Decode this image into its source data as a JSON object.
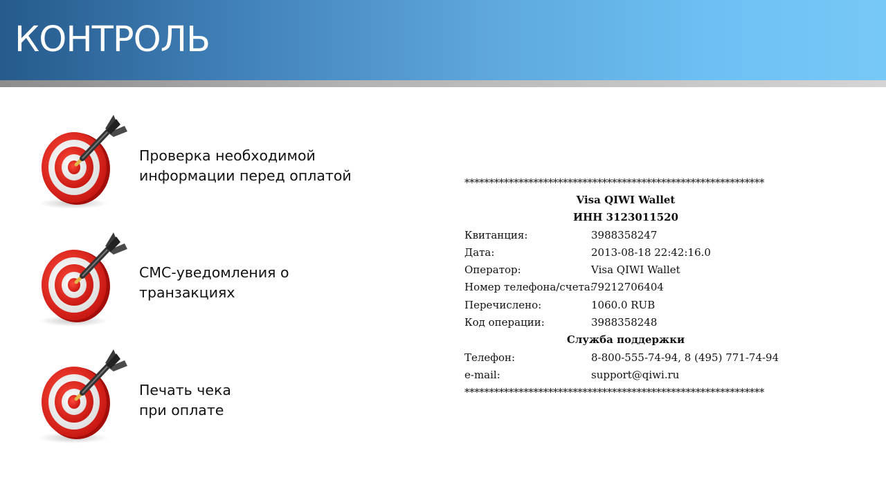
{
  "slide": {
    "title": "КОНТРОЛЬ"
  },
  "items": [
    {
      "icon": "dart-target-icon",
      "lines": [
        "Проверка необходимой",
        "информации перед оплатой"
      ]
    },
    {
      "icon": "dart-target-icon",
      "lines": [
        "СМС-уведомления о",
        "транзакциях"
      ]
    },
    {
      "icon": "dart-target-icon",
      "lines": [
        "Печать чека",
        "при оплате"
      ]
    }
  ],
  "receipt": {
    "stars": "*************************************************************",
    "company": "Visa QIWI Wallet",
    "inn": "ИНН 3123011520",
    "rows": [
      {
        "label": "Квитанция:",
        "value": "3988358247"
      },
      {
        "label": "Дата:",
        "value": "2013-08-18 22:42:16.0"
      },
      {
        "label": "Оператор:",
        "value": "Visa QIWI Wallet"
      },
      {
        "label": "Номер телефона/счета:",
        "value": "79212706404"
      },
      {
        "label": "Перечислено:",
        "value": "1060.0 RUB"
      },
      {
        "label": "Код операции:",
        "value": "3988358248"
      }
    ],
    "support_title": "Служба поддержки",
    "support_rows": [
      {
        "label": "Телефон:",
        "value": "8-800-555-74-94, 8 (495) 771-74-94"
      },
      {
        "label": "e-mail:",
        "value": "support@qiwi.ru"
      }
    ]
  },
  "colors": {
    "header_dark": "#265a8c",
    "header_light": "#77c8f6",
    "target_red": "#e0211b"
  }
}
